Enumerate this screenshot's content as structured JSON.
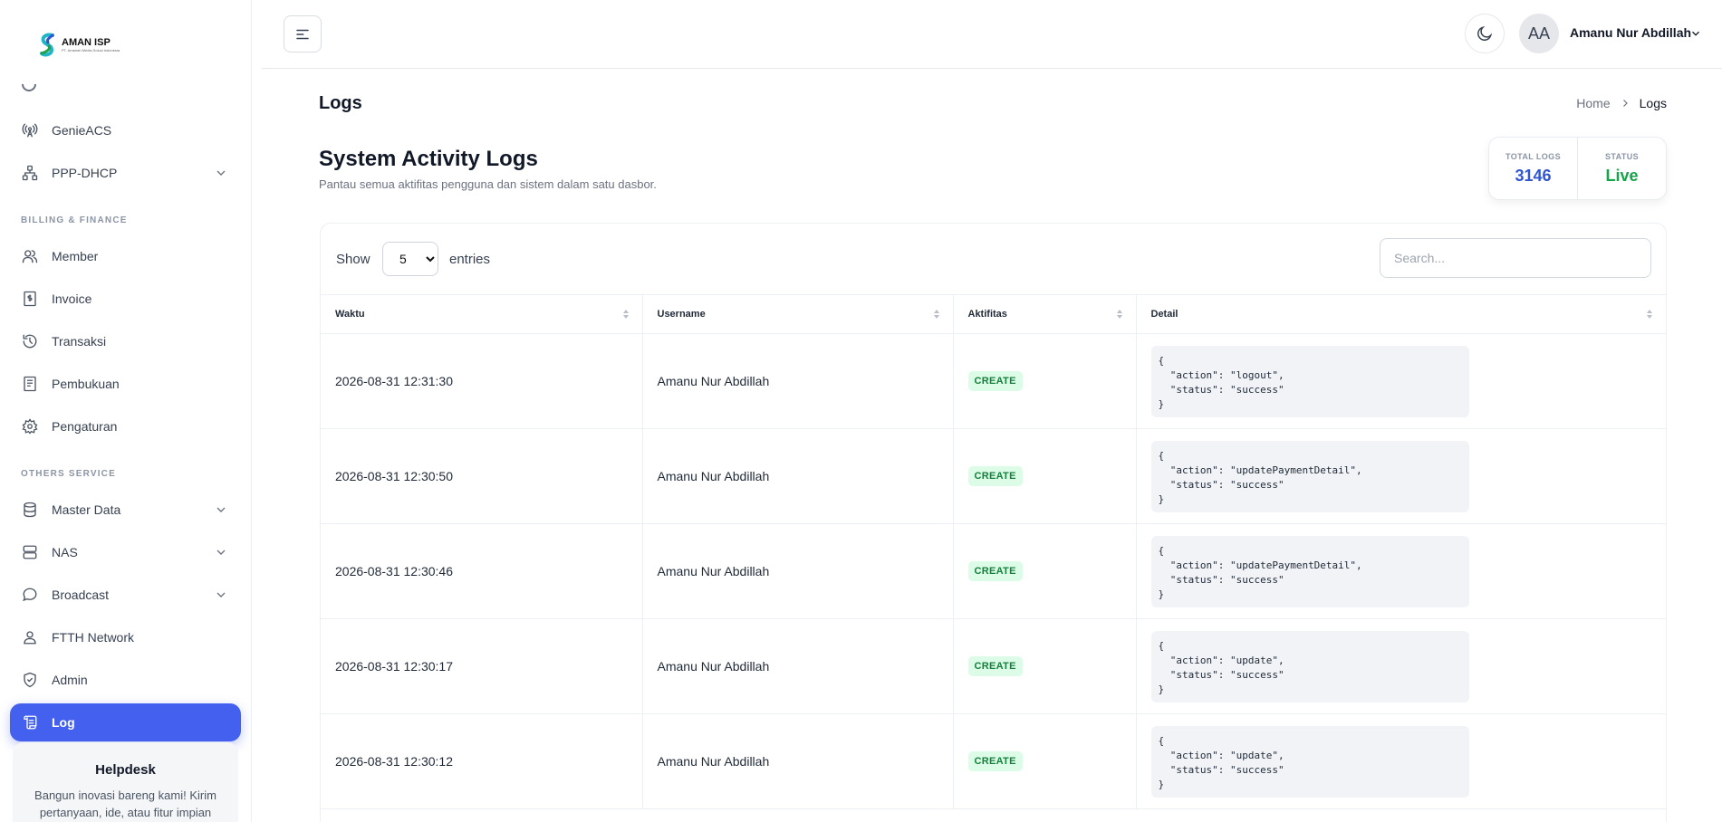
{
  "brand": {
    "name": "AMAN ISP",
    "tagline": "PT. Amanah Media Solusi Indonesia"
  },
  "sidebar": {
    "items_top": [
      {
        "label": "GenieACS",
        "icon": "antenna-icon"
      },
      {
        "label": "PPP-DHCP",
        "icon": "network-icon"
      }
    ],
    "section_billing": "BILLING & FINANCE",
    "items_billing": [
      {
        "label": "Member",
        "icon": "users-icon"
      },
      {
        "label": "Invoice",
        "icon": "invoice-icon"
      },
      {
        "label": "Transaksi",
        "icon": "history-icon"
      },
      {
        "label": "Pembukuan",
        "icon": "ledger-icon"
      },
      {
        "label": "Pengaturan",
        "icon": "gear-icon"
      }
    ],
    "section_others": "OTHERS SERVICE",
    "items_others": [
      {
        "label": "Master Data",
        "icon": "database-icon"
      },
      {
        "label": "NAS",
        "icon": "server-icon"
      },
      {
        "label": "Broadcast",
        "icon": "chat-icon"
      },
      {
        "label": "FTTH Network",
        "icon": "user-pin-icon"
      },
      {
        "label": "Admin",
        "icon": "shield-icon"
      },
      {
        "label": "Log",
        "icon": "scroll-icon"
      }
    ],
    "helpdesk": {
      "title": "Helpdesk",
      "text": "Bangun inovasi bareng kami! Kirim pertanyaan, ide, atau fitur impian"
    }
  },
  "header": {
    "user": {
      "initials": "AA",
      "name": "Amanu Nur Abdillah"
    }
  },
  "page": {
    "title": "Logs",
    "breadcrumb": {
      "home": "Home",
      "current": "Logs"
    },
    "section_title": "System Activity Logs",
    "section_subtitle": "Pantau semua aktifitas pengguna dan sistem dalam satu dasbor.",
    "stats": {
      "total_label": "TOTAL LOGS",
      "total_value": "3146",
      "status_label": "STATUS",
      "status_value": "Live"
    }
  },
  "table": {
    "show_label": "Show",
    "entries_value": "5",
    "entries_label": "entries",
    "search_placeholder": "Search...",
    "columns": [
      "Waktu",
      "Username",
      "Aktifitas",
      "Detail"
    ],
    "rows": [
      {
        "waktu": "2026-08-31 12:31:30",
        "username": "Amanu Nur Abdillah",
        "aktifitas": "CREATE",
        "detail": "{\n  \"action\": \"logout\",\n  \"status\": \"success\"\n}"
      },
      {
        "waktu": "2026-08-31 12:30:50",
        "username": "Amanu Nur Abdillah",
        "aktifitas": "CREATE",
        "detail": "{\n  \"action\": \"updatePaymentDetail\",\n  \"status\": \"success\"\n}"
      },
      {
        "waktu": "2026-08-31 12:30:46",
        "username": "Amanu Nur Abdillah",
        "aktifitas": "CREATE",
        "detail": "{\n  \"action\": \"updatePaymentDetail\",\n  \"status\": \"success\"\n}"
      },
      {
        "waktu": "2026-08-31 12:30:17",
        "username": "Amanu Nur Abdillah",
        "aktifitas": "CREATE",
        "detail": "{\n  \"action\": \"update\",\n  \"status\": \"success\"\n}"
      },
      {
        "waktu": "2026-08-31 12:30:12",
        "username": "Amanu Nur Abdillah",
        "aktifitas": "CREATE",
        "detail": "{\n  \"action\": \"update\",\n  \"status\": \"success\"\n}"
      }
    ]
  },
  "colors": {
    "accent": "#4361ee",
    "success": "#16a34a",
    "total": "#2f55d4"
  }
}
